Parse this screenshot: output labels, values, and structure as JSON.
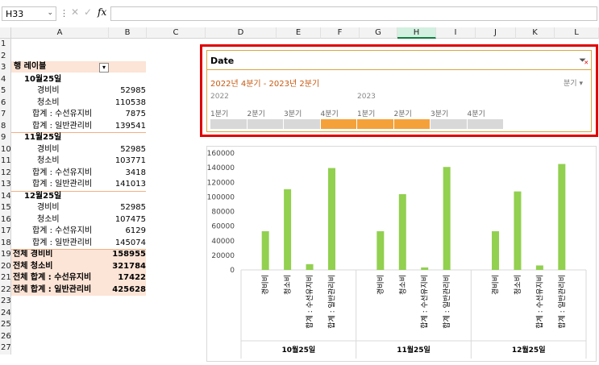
{
  "formula_bar": {
    "name_box": "H33",
    "fx_label": "fx",
    "formula": ""
  },
  "columns": [
    "A",
    "B",
    "C",
    "D",
    "E",
    "F",
    "G",
    "H",
    "I",
    "J",
    "K",
    "L"
  ],
  "selected_column": "H",
  "rows": [
    "1",
    "2",
    "3",
    "4",
    "5",
    "6",
    "7",
    "8",
    "9",
    "10",
    "11",
    "12",
    "13",
    "14",
    "15",
    "16",
    "17",
    "18",
    "19",
    "20",
    "21",
    "22",
    "23",
    "24",
    "25",
    "26",
    "27"
  ],
  "pivot": {
    "header_label": "행 레이블",
    "groups": [
      {
        "label": "10월25일",
        "items": [
          {
            "label": "경비비",
            "value": "52985"
          },
          {
            "label": "청소비",
            "value": "110538"
          },
          {
            "label": "합계 : 수선유지비",
            "value": "7875"
          },
          {
            "label": "합계 : 일반관리비",
            "value": "139541"
          }
        ]
      },
      {
        "label": "11월25일",
        "items": [
          {
            "label": "경비비",
            "value": "52985"
          },
          {
            "label": "청소비",
            "value": "103771"
          },
          {
            "label": "합계 : 수선유지비",
            "value": "3418"
          },
          {
            "label": "합계 : 일반관리비",
            "value": "141013"
          }
        ]
      },
      {
        "label": "12월25일",
        "items": [
          {
            "label": "경비비",
            "value": "52985"
          },
          {
            "label": "청소비",
            "value": "107475"
          },
          {
            "label": "합계 : 수선유지비",
            "value": "6129"
          },
          {
            "label": "합계 : 일반관리비",
            "value": "145074"
          }
        ]
      }
    ],
    "totals": [
      {
        "label": "전체  경비비",
        "value": "158955"
      },
      {
        "label": "전체  청소비",
        "value": "321784"
      },
      {
        "label": "전체 합계 : 수선유지비",
        "value": "17422"
      },
      {
        "label": "전체 합계 : 일반관리비",
        "value": "425628"
      }
    ]
  },
  "slicer": {
    "title": "Date",
    "range": "2022년 4분기 - 2023년 2분기",
    "level": "분기",
    "years": [
      "2022",
      "2023"
    ],
    "quarters": [
      "1분기",
      "2분기",
      "3분기",
      "4분기",
      "1분기",
      "2분기",
      "3분기",
      "4분기"
    ],
    "selected_quarter_index": [
      3,
      4,
      5
    ]
  },
  "chart_data": {
    "type": "bar",
    "color": "#92d050",
    "ylim": [
      0,
      160000
    ],
    "yticks": [
      "0",
      "20000",
      "40000",
      "60000",
      "80000",
      "100000",
      "120000",
      "140000",
      "160000"
    ],
    "groups": [
      {
        "label": "10월25일",
        "categories": [
          "경비비",
          "청소비",
          "합계 : 수선유지비",
          "합계 : 일반관리비"
        ],
        "values": [
          52985,
          110538,
          7875,
          139541
        ]
      },
      {
        "label": "11월25일",
        "categories": [
          "경비비",
          "청소비",
          "합계 : 수선유지비",
          "합계 : 일반관리비"
        ],
        "values": [
          52985,
          103771,
          3418,
          141013
        ]
      },
      {
        "label": "12월25일",
        "categories": [
          "경비비",
          "청소비",
          "합계 : 수선유지비",
          "합계 : 일반관리비"
        ],
        "values": [
          52985,
          107475,
          6129,
          145074
        ]
      }
    ]
  }
}
